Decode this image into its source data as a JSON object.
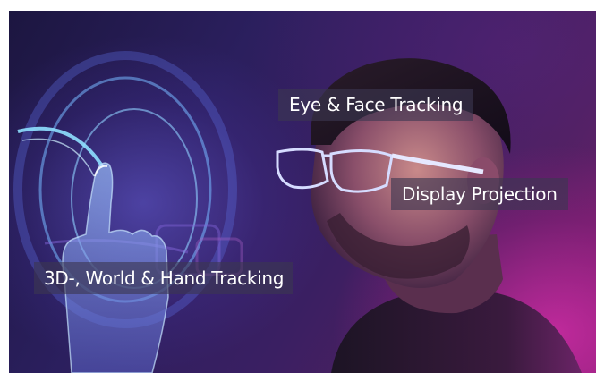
{
  "image": {
    "description_icon": "person-with-smart-glasses-image"
  },
  "labels": {
    "eye_face": "Eye & Face Tracking",
    "display": "Display Projection",
    "world_hand": "3D-, World & Hand Tracking"
  },
  "colors": {
    "label_background": "#3c3750",
    "label_text": "#ffffff",
    "accent_blue": "#6fc6ff",
    "accent_magenta": "#d42da8"
  }
}
